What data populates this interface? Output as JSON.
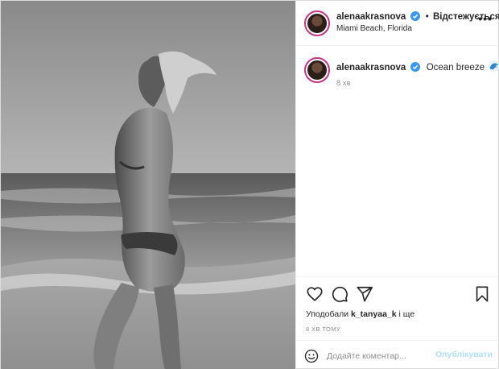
{
  "post": {
    "photo": {
      "icon": "beach-photo",
      "style": "black-and-white"
    },
    "header": {
      "username": "alenaakrasnova",
      "follow_separator": "•",
      "follow_label": "Відстежується",
      "location": "Miami Beach, Florida",
      "more_label": "•••"
    },
    "caption": {
      "username": "alenaakrasnova",
      "text": "Ocean breeze",
      "emoji": "wave-icon",
      "time": "8 хв"
    },
    "actions": {
      "likes_prefix": "Уподобали ",
      "likes_user": "k_tanyaa_k",
      "likes_suffix": " і ще",
      "posted_ago": "8 ХВ ТОМУ"
    },
    "composer": {
      "placeholder": "Додайте коментар...",
      "publish_label": "Опублікувати"
    }
  },
  "colors": {
    "verified": "#3897f0",
    "avatar_ring": "#c13584",
    "publish_disabled": "#b2dffc",
    "muted": "#8e8e8e"
  }
}
